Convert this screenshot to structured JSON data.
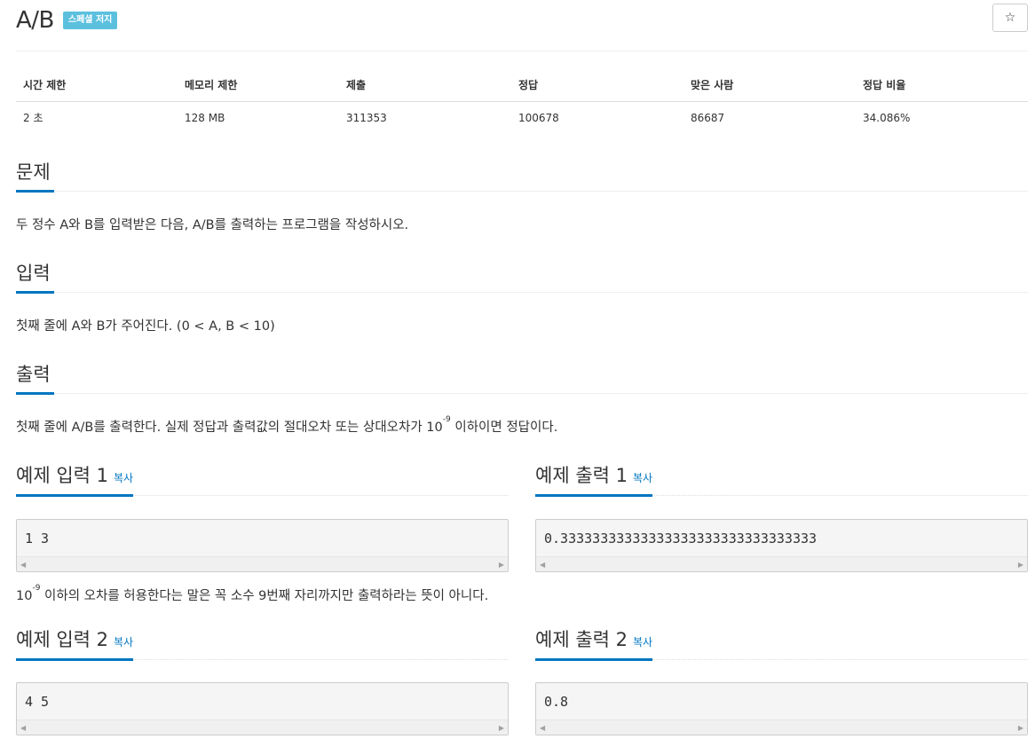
{
  "problem": {
    "title": "A/B",
    "badge": "스페셜 저지",
    "star_icon": "☆"
  },
  "info_table": {
    "headers": [
      "시간 제한",
      "메모리 제한",
      "제출",
      "정답",
      "맞은 사람",
      "정답 비율"
    ],
    "values": [
      "2 초",
      "128 MB",
      "311353",
      "100678",
      "86687",
      "34.086%"
    ]
  },
  "sections": {
    "problem": {
      "heading": "문제",
      "body": "두 정수 A와 B를 입력받은 다음, A/B를 출력하는 프로그램을 작성하시오."
    },
    "input": {
      "heading": "입력",
      "body": "첫째 줄에 A와 B가 주어진다. (0 < A, B < 10)"
    },
    "output": {
      "heading": "출력",
      "body_pre": "첫째 줄에 A/B를 출력한다. 실제 정답과 출력값의 절대오차 또는 상대오차가 10",
      "body_sup": "-9",
      "body_post": " 이하이면 정답이다."
    }
  },
  "samples": {
    "copy_label": "복사",
    "input1": {
      "heading": "예제 입력 1",
      "content": "1 3"
    },
    "output1": {
      "heading": "예제 출력 1",
      "content": "0.33333333333333333333333333333333"
    },
    "input2": {
      "heading": "예제 입력 2",
      "content": "4 5"
    },
    "output2": {
      "heading": "예제 출력 2",
      "content": "0.8"
    }
  },
  "note": {
    "pre": "10",
    "sup": "-9",
    "post": " 이하의 오차를 허용한다는 말은 꼭 소수 9번째 자리까지만 출력하라는 뜻이 아니다."
  },
  "scroll": {
    "left_arrow": "◀",
    "right_arrow": "▶"
  },
  "colors": {
    "accent": "#0076c0",
    "badge": "#5bc0de"
  }
}
